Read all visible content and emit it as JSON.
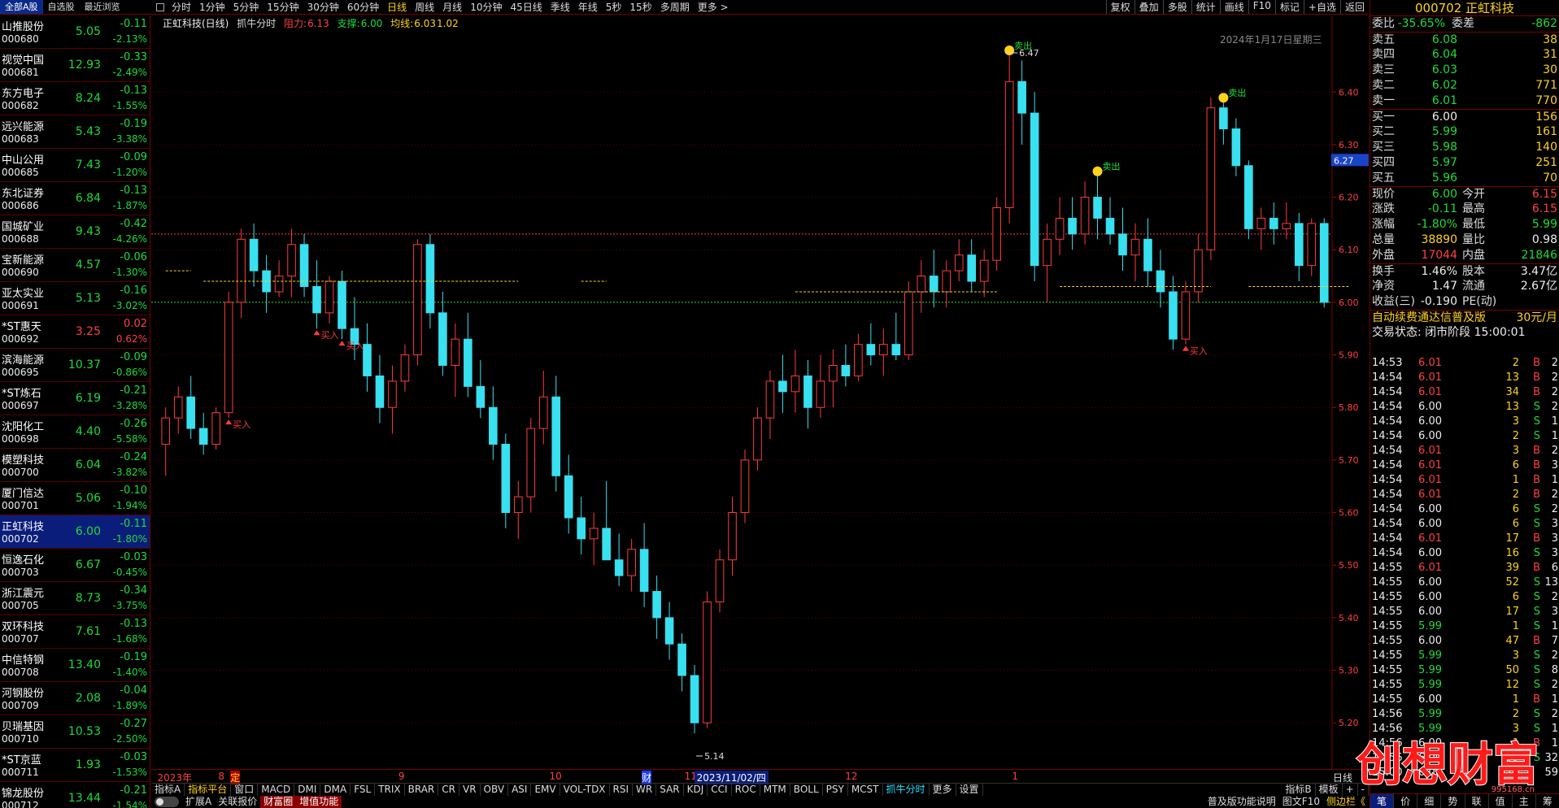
{
  "top_tabs": [
    "全部A股",
    "自选股",
    "最近浏览"
  ],
  "stocks": [
    {
      "name": "山推股份",
      "code": "000680",
      "price": "5.05",
      "chg": "-0.11",
      "pct": "-2.13%"
    },
    {
      "name": "视觉中国",
      "code": "000681",
      "price": "12.93",
      "chg": "-0.33",
      "pct": "-2.49%"
    },
    {
      "name": "东方电子",
      "code": "000682",
      "price": "8.24",
      "chg": "-0.13",
      "pct": "-1.55%"
    },
    {
      "name": "远兴能源",
      "code": "000683",
      "price": "5.43",
      "chg": "-0.19",
      "pct": "-3.38%"
    },
    {
      "name": "中山公用",
      "code": "000685",
      "price": "7.43",
      "chg": "-0.09",
      "pct": "-1.20%"
    },
    {
      "name": "东北证券",
      "code": "000686",
      "price": "6.84",
      "chg": "-0.13",
      "pct": "-1.87%"
    },
    {
      "name": "国城矿业",
      "code": "000688",
      "price": "9.43",
      "chg": "-0.42",
      "pct": "-4.26%"
    },
    {
      "name": "宝新能源",
      "code": "000690",
      "price": "4.57",
      "chg": "-0.06",
      "pct": "-1.30%"
    },
    {
      "name": "亚太实业",
      "code": "000691",
      "price": "5.13",
      "chg": "-0.16",
      "pct": "-3.02%"
    },
    {
      "name": "*ST惠天",
      "code": "000692",
      "price": "3.25",
      "chg": "0.02",
      "pct": "0.62%",
      "up": true
    },
    {
      "name": "滨海能源",
      "code": "000695",
      "price": "10.37",
      "chg": "-0.09",
      "pct": "-0.86%"
    },
    {
      "name": "*ST炼石",
      "code": "000697",
      "price": "6.19",
      "chg": "-0.21",
      "pct": "-3.28%"
    },
    {
      "name": "沈阳化工",
      "code": "000698",
      "price": "4.40",
      "chg": "-0.26",
      "pct": "-5.58%"
    },
    {
      "name": "模塑科技",
      "code": "000700",
      "price": "6.04",
      "chg": "-0.24",
      "pct": "-3.82%"
    },
    {
      "name": "厦门信达",
      "code": "000701",
      "price": "5.06",
      "chg": "-0.10",
      "pct": "-1.94%"
    },
    {
      "name": "正虹科技",
      "code": "000702",
      "price": "6.00",
      "chg": "-0.11",
      "pct": "-1.80%",
      "sel": true
    },
    {
      "name": "恒逸石化",
      "code": "000703",
      "price": "6.67",
      "chg": "-0.03",
      "pct": "-0.45%"
    },
    {
      "name": "浙江震元",
      "code": "000705",
      "price": "8.73",
      "chg": "-0.34",
      "pct": "-3.75%"
    },
    {
      "name": "双环科技",
      "code": "000707",
      "price": "7.61",
      "chg": "-0.13",
      "pct": "-1.68%"
    },
    {
      "name": "中信特钢",
      "code": "000708",
      "price": "13.40",
      "chg": "-0.19",
      "pct": "-1.40%"
    },
    {
      "name": "河钢股份",
      "code": "000709",
      "price": "2.08",
      "chg": "-0.04",
      "pct": "-1.89%"
    },
    {
      "name": "贝瑞基因",
      "code": "000710",
      "price": "10.53",
      "chg": "-0.27",
      "pct": "-2.50%"
    },
    {
      "name": "*ST京蓝",
      "code": "000711",
      "price": "1.93",
      "chg": "-0.03",
      "pct": "-1.53%"
    },
    {
      "name": "锦龙股份",
      "code": "000712",
      "price": "13.44",
      "chg": "-0.21",
      "pct": "-1.54%"
    }
  ],
  "periods": [
    "分时",
    "1分钟",
    "5分钟",
    "15分钟",
    "30分钟",
    "60分钟",
    "日线",
    "周线",
    "月线",
    "10分钟",
    "45日线",
    "季线",
    "年线",
    "5秒",
    "15秒",
    "多周期",
    "更多 >"
  ],
  "period_active": "日线",
  "toolbar_right": [
    "复权",
    "叠加",
    "多股",
    "统计",
    "画线",
    "F10",
    "标记",
    "+自选",
    "返回"
  ],
  "chart_header": {
    "name": "正虹科技(日线)",
    "indicator": "抓牛分时",
    "resist_label": "阻力:",
    "resist": "6.13",
    "support_label": "支撑:",
    "support": "6.00",
    "mid_label": "均线:",
    "mid": "6.03",
    "ratio": "1.02",
    "date": "2024年1月17日星期三"
  },
  "chart_data": {
    "type": "candlestick",
    "ylim": [
      5.14,
      6.47
    ],
    "yticks": [
      "6.40",
      "6.30",
      "6.20",
      "6.10",
      "6.00",
      "5.90",
      "5.80",
      "5.70",
      "5.60",
      "5.50",
      "5.40",
      "5.30",
      "5.20"
    ],
    "current_price_tag": "6.27",
    "annot_high": "6.47",
    "annot_low": "5.14",
    "resist_line": 6.13,
    "support_line": 6.0,
    "signals": [
      {
        "i": 5,
        "type": "buy",
        "label": "买入"
      },
      {
        "i": 12,
        "type": "buy",
        "label": "买入"
      },
      {
        "i": 14,
        "type": "buy",
        "label": "买入"
      },
      {
        "i": 67,
        "type": "sell",
        "label": "卖出"
      },
      {
        "i": 74,
        "type": "sell",
        "label": "卖出"
      },
      {
        "i": 81,
        "type": "buy",
        "label": "买入"
      },
      {
        "i": 84,
        "type": "sell",
        "label": "卖出"
      }
    ],
    "candles": [
      [
        5.73,
        5.8,
        5.67,
        5.78
      ],
      [
        5.78,
        5.84,
        5.75,
        5.82
      ],
      [
        5.82,
        5.86,
        5.74,
        5.76
      ],
      [
        5.76,
        5.79,
        5.71,
        5.73
      ],
      [
        5.73,
        5.8,
        5.72,
        5.79
      ],
      [
        5.79,
        6.02,
        5.78,
        6.0
      ],
      [
        6.0,
        6.14,
        5.97,
        6.12
      ],
      [
        6.12,
        6.15,
        6.03,
        6.06
      ],
      [
        6.06,
        6.09,
        5.98,
        6.02
      ],
      [
        6.02,
        6.08,
        6.01,
        6.05
      ],
      [
        6.05,
        6.14,
        6.01,
        6.11
      ],
      [
        6.11,
        6.13,
        6.01,
        6.03
      ],
      [
        6.03,
        6.08,
        5.95,
        5.98
      ],
      [
        5.98,
        6.05,
        5.96,
        6.04
      ],
      [
        6.04,
        6.06,
        5.93,
        5.95
      ],
      [
        5.95,
        6.01,
        5.89,
        5.92
      ],
      [
        5.92,
        5.96,
        5.83,
        5.86
      ],
      [
        5.86,
        5.9,
        5.77,
        5.8
      ],
      [
        5.8,
        5.88,
        5.75,
        5.85
      ],
      [
        5.85,
        5.92,
        5.83,
        5.9
      ],
      [
        5.9,
        6.12,
        5.88,
        6.11
      ],
      [
        6.11,
        6.13,
        5.95,
        5.98
      ],
      [
        5.98,
        6.02,
        5.86,
        5.88
      ],
      [
        5.88,
        5.96,
        5.82,
        5.93
      ],
      [
        5.93,
        5.98,
        5.82,
        5.84
      ],
      [
        5.84,
        5.89,
        5.78,
        5.8
      ],
      [
        5.8,
        5.84,
        5.7,
        5.73
      ],
      [
        5.73,
        5.75,
        5.57,
        5.6
      ],
      [
        5.6,
        5.66,
        5.55,
        5.63
      ],
      [
        5.63,
        5.78,
        5.6,
        5.76
      ],
      [
        5.76,
        5.87,
        5.73,
        5.82
      ],
      [
        5.82,
        5.86,
        5.64,
        5.67
      ],
      [
        5.67,
        5.71,
        5.56,
        5.59
      ],
      [
        5.59,
        5.63,
        5.52,
        5.55
      ],
      [
        5.55,
        5.6,
        5.5,
        5.57
      ],
      [
        5.57,
        5.66,
        5.53,
        5.51
      ],
      [
        5.51,
        5.56,
        5.46,
        5.48
      ],
      [
        5.48,
        5.55,
        5.45,
        5.53
      ],
      [
        5.53,
        5.58,
        5.42,
        5.45
      ],
      [
        5.45,
        5.48,
        5.36,
        5.4
      ],
      [
        5.4,
        5.43,
        5.32,
        5.35
      ],
      [
        5.35,
        5.37,
        5.26,
        5.29
      ],
      [
        5.29,
        5.31,
        5.18,
        5.2
      ],
      [
        5.2,
        5.45,
        5.19,
        5.43
      ],
      [
        5.43,
        5.53,
        5.41,
        5.51
      ],
      [
        5.51,
        5.63,
        5.48,
        5.6
      ],
      [
        5.6,
        5.72,
        5.58,
        5.7
      ],
      [
        5.7,
        5.8,
        5.68,
        5.78
      ],
      [
        5.78,
        5.87,
        5.74,
        5.85
      ],
      [
        5.85,
        5.9,
        5.79,
        5.83
      ],
      [
        5.83,
        5.91,
        5.79,
        5.86
      ],
      [
        5.86,
        5.89,
        5.76,
        5.8
      ],
      [
        5.8,
        5.9,
        5.78,
        5.85
      ],
      [
        5.85,
        5.91,
        5.8,
        5.88
      ],
      [
        5.88,
        5.92,
        5.84,
        5.86
      ],
      [
        5.86,
        5.94,
        5.85,
        5.92
      ],
      [
        5.92,
        5.96,
        5.88,
        5.9
      ],
      [
        5.9,
        5.95,
        5.86,
        5.92
      ],
      [
        5.92,
        5.98,
        5.89,
        5.9
      ],
      [
        5.9,
        6.04,
        5.89,
        6.02
      ],
      [
        6.02,
        6.08,
        5.98,
        6.05
      ],
      [
        6.05,
        6.1,
        5.99,
        6.02
      ],
      [
        6.02,
        6.08,
        5.99,
        6.06
      ],
      [
        6.06,
        6.12,
        6.04,
        6.09
      ],
      [
        6.09,
        6.12,
        6.02,
        6.04
      ],
      [
        6.04,
        6.1,
        6.01,
        6.08
      ],
      [
        6.08,
        6.2,
        6.06,
        6.18
      ],
      [
        6.18,
        6.47,
        6.15,
        6.42
      ],
      [
        6.42,
        6.46,
        6.3,
        6.36
      ],
      [
        6.36,
        6.4,
        6.04,
        6.07
      ],
      [
        6.07,
        6.15,
        6.0,
        6.12
      ],
      [
        6.12,
        6.2,
        6.09,
        6.16
      ],
      [
        6.16,
        6.2,
        6.1,
        6.13
      ],
      [
        6.13,
        6.23,
        6.11,
        6.2
      ],
      [
        6.2,
        6.24,
        6.12,
        6.16
      ],
      [
        6.16,
        6.2,
        6.11,
        6.13
      ],
      [
        6.13,
        6.18,
        6.06,
        6.09
      ],
      [
        6.09,
        6.15,
        6.04,
        6.12
      ],
      [
        6.12,
        6.16,
        6.03,
        6.06
      ],
      [
        6.06,
        6.1,
        5.99,
        6.02
      ],
      [
        6.02,
        6.05,
        5.91,
        5.93
      ],
      [
        5.93,
        6.04,
        5.92,
        6.02
      ],
      [
        6.02,
        6.13,
        6.0,
        6.1
      ],
      [
        6.1,
        6.39,
        6.08,
        6.37
      ],
      [
        6.37,
        6.38,
        6.3,
        6.33
      ],
      [
        6.33,
        6.35,
        6.24,
        6.26
      ],
      [
        6.26,
        6.27,
        6.12,
        6.14
      ],
      [
        6.14,
        6.18,
        6.1,
        6.16
      ],
      [
        6.16,
        6.19,
        6.11,
        6.14
      ],
      [
        6.14,
        6.19,
        6.12,
        6.15
      ],
      [
        6.15,
        6.17,
        6.04,
        6.07
      ],
      [
        6.07,
        6.16,
        6.05,
        6.15
      ],
      [
        6.15,
        6.16,
        5.99,
        6.0
      ]
    ]
  },
  "x_labels": [
    "2023年",
    "8",
    "9",
    "10",
    "11",
    "2023/11/02/四",
    "12",
    "1"
  ],
  "x_unit": "日线",
  "x_markers": [
    "定",
    "财"
  ],
  "indicator_tabs": [
    "指标A",
    "指标平台",
    "窗口",
    "MACD",
    "DMI",
    "DMA",
    "FSL",
    "TRIX",
    "BRAR",
    "CR",
    "VR",
    "OBV",
    "ASI",
    "EMV",
    "VOL-TDX",
    "RSI",
    "WR",
    "SAR",
    "KDJ",
    "CCI",
    "ROC",
    "MTM",
    "BOLL",
    "PSY",
    "MCST",
    "抓牛分时",
    "更多",
    "设置"
  ],
  "indicator_right": [
    "指标B",
    "模板",
    "+",
    "-"
  ],
  "bottom_items": [
    "扩展A",
    "关联报价",
    "财富圈",
    "增值功能"
  ],
  "bottom_right": [
    "普及版功能说明",
    "图文F10",
    "侧边栏《"
  ],
  "rpanel": {
    "title": "000702 正虹科技",
    "weibi_label": "委比",
    "weibi": "-35.65%",
    "weicha_label": "委差",
    "weicha": "-862",
    "asks": [
      {
        "l": "卖五",
        "p": "6.08",
        "v": "38"
      },
      {
        "l": "卖四",
        "p": "6.04",
        "v": "31"
      },
      {
        "l": "卖三",
        "p": "6.03",
        "v": "30"
      },
      {
        "l": "卖二",
        "p": "6.02",
        "v": "771"
      },
      {
        "l": "卖一",
        "p": "6.01",
        "v": "770"
      }
    ],
    "bids": [
      {
        "l": "买一",
        "p": "6.00",
        "v": "156"
      },
      {
        "l": "买二",
        "p": "5.99",
        "v": "161"
      },
      {
        "l": "买三",
        "p": "5.98",
        "v": "140"
      },
      {
        "l": "买四",
        "p": "5.97",
        "v": "251"
      },
      {
        "l": "买五",
        "p": "5.96",
        "v": "70"
      }
    ],
    "stats": [
      [
        "现价",
        "6.00",
        "今开",
        "6.15"
      ],
      [
        "涨跌",
        "-0.11",
        "最高",
        "6.15"
      ],
      [
        "涨幅",
        "-1.80%",
        "最低",
        "5.99"
      ],
      [
        "总量",
        "38890",
        "量比",
        "0.98"
      ],
      [
        "外盘",
        "17044",
        "内盘",
        "21846"
      ]
    ],
    "stats2": [
      [
        "换手",
        "1.46%",
        "股本",
        "3.47亿"
      ],
      [
        "净资",
        "1.47",
        "流通",
        "2.67亿"
      ],
      [
        "收益(三)",
        "-0.190",
        "PE(动)",
        ""
      ]
    ],
    "ad_text": "自动续费通达信普及版",
    "ad_price": "30元/月",
    "status": "交易状态: 闭市阶段 15:00:01",
    "ticks": [
      [
        "14:53",
        "6.01",
        "2",
        "B",
        "2"
      ],
      [
        "14:54",
        "6.01",
        "13",
        "B",
        "2"
      ],
      [
        "14:54",
        "6.01",
        "34",
        "B",
        "2"
      ],
      [
        "14:54",
        "6.00",
        "13",
        "S",
        "2"
      ],
      [
        "14:54",
        "6.00",
        "3",
        "S",
        "1"
      ],
      [
        "14:54",
        "6.00",
        "2",
        "S",
        "1"
      ],
      [
        "14:54",
        "6.01",
        "3",
        "B",
        "2"
      ],
      [
        "14:54",
        "6.01",
        "6",
        "B",
        "3"
      ],
      [
        "14:54",
        "6.01",
        "1",
        "B",
        "1"
      ],
      [
        "14:54",
        "6.01",
        "2",
        "B",
        "2"
      ],
      [
        "14:54",
        "6.00",
        "6",
        "S",
        "2"
      ],
      [
        "14:54",
        "6.00",
        "6",
        "S",
        "3"
      ],
      [
        "14:54",
        "6.01",
        "17",
        "B",
        "3"
      ],
      [
        "14:54",
        "6.00",
        "16",
        "S",
        "3"
      ],
      [
        "14:55",
        "6.01",
        "39",
        "B",
        "6"
      ],
      [
        "14:55",
        "6.00",
        "52",
        "S",
        "13"
      ],
      [
        "14:55",
        "6.00",
        "6",
        "S",
        "2"
      ],
      [
        "14:55",
        "6.00",
        "17",
        "S",
        "3"
      ],
      [
        "14:55",
        "5.99",
        "1",
        "S",
        "1"
      ],
      [
        "14:55",
        "6.00",
        "47",
        "B",
        "7"
      ],
      [
        "14:55",
        "5.99",
        "3",
        "S",
        "2"
      ],
      [
        "14:55",
        "5.99",
        "50",
        "S",
        "8"
      ],
      [
        "14:55",
        "5.99",
        "12",
        "S",
        "2"
      ],
      [
        "14:55",
        "6.00",
        "1",
        "B",
        "1"
      ],
      [
        "14:56",
        "5.99",
        "2",
        "S",
        "2"
      ],
      [
        "14:56",
        "5.99",
        "3",
        "S",
        "1"
      ],
      [
        "14:56",
        "6.00",
        "1",
        "B",
        "1"
      ],
      [
        "14:56",
        "6.00",
        "59",
        "S",
        "32"
      ],
      [
        "15:00",
        "6.00",
        "224",
        "",
        "59"
      ]
    ],
    "tabs": [
      "笔",
      "价",
      "细",
      "势",
      "联",
      "值",
      "主",
      "筹"
    ]
  },
  "watermark": {
    "main": "创想财富",
    "url": "995168.cn"
  },
  "colors": {
    "up": "#ff3b3b",
    "down": "#38e0f0",
    "resist": "#ff3b3b",
    "support": "#22dd22",
    "bull": "#ffd21e"
  }
}
